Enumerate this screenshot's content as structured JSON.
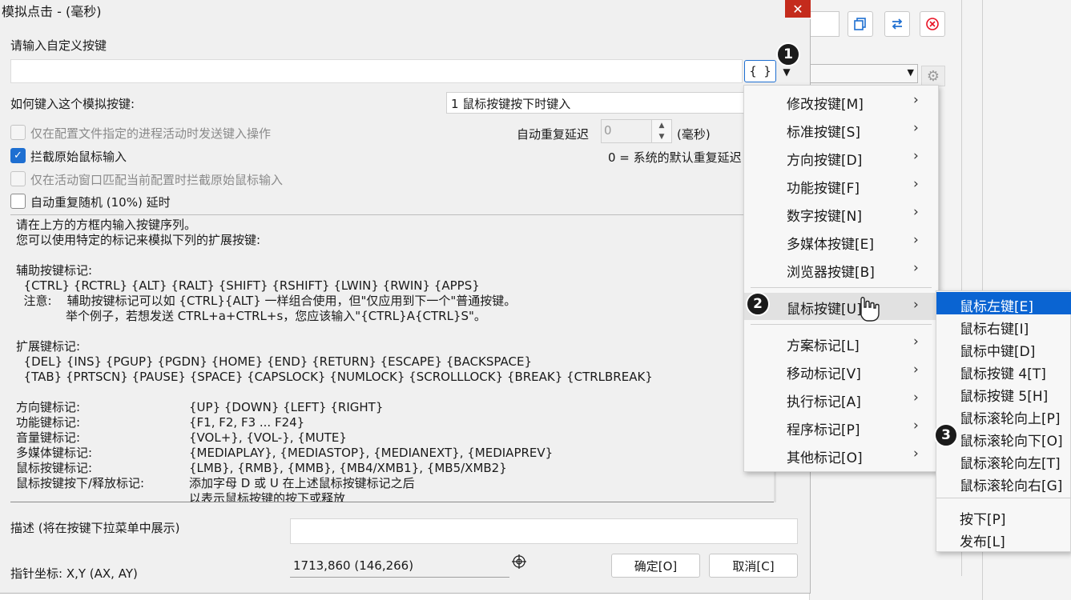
{
  "dialog": {
    "title": "模拟点击 - (毫秒)",
    "close_glyph": "✕",
    "input_label": "请输入自定义按键",
    "braces_label": "{ }",
    "how_label": "如何键入这个模拟按键:",
    "how_value": "1 鼠标按键按下时键入",
    "opt_process": "仅在配置文件指定的进程活动时发送键入操作",
    "opt_intercept": "拦截原始鼠标输入",
    "opt_window": "仅在活动窗口匹配当前配置时拦截原始鼠标输入",
    "opt_random": "自动重复随机 (10%) 延时",
    "repeat_label": "自动重复延迟",
    "repeat_value": "0",
    "repeat_unit": "(毫秒)",
    "repeat_note": "0 = 系统的默认重复延迟",
    "desc_label": "描述 (将在按键下拉菜单中展示)",
    "pointer_label": "指针坐标: X,Y (AX, AY)",
    "pointer_value": "1713,860 (146,266)",
    "ok_label": "确定[O]",
    "cancel_label": "取消[C]"
  },
  "help": {
    "l1": "请在上方的方框内输入按键序列。",
    "l2": "您可以使用特定的标记来模拟下列的扩展按键:",
    "l3": "辅助按键标记:",
    "l4": "  {CTRL} {RCTRL} {ALT} {RALT} {SHIFT} {RSHIFT} {LWIN} {RWIN} {APPS}",
    "l5": "  注意:    辅助按键标记可以如 {CTRL}{ALT} 一样组合使用，但\"仅应用到下一个\"普通按键。",
    "l6": "             举个例子，若想发送 CTRL+a+CTRL+s，您应该输入\"{CTRL}A{CTRL}S\"。",
    "l7": "扩展键标记:",
    "l8": "  {DEL} {INS} {PGUP} {PGDN} {HOME} {END} {RETURN} {ESCAPE} {BACKSPACE}",
    "l9": "  {TAB} {PRTSCN} {PAUSE} {SPACE} {CAPSLOCK} {NUMLOCK} {SCROLLLOCK} {BREAK} {CTRLBREAK}",
    "k1": "方向键标记:",
    "v1": "{UP} {DOWN} {LEFT} {RIGHT}",
    "k2": "功能键标记:",
    "v2": "{F1, F2, F3 ... F24}",
    "k3": "音量键标记:",
    "v3": "{VOL+}, {VOL-}, {MUTE}",
    "k4": "多媒体键标记:",
    "v4": "{MEDIAPLAY}, {MEDIASTOP}, {MEDIANEXT}, {MEDIAPREV}",
    "k5": "鼠标按键标记:",
    "v5": "{LMB}, {RMB}, {MMB}, {MB4/XMB1}, {MB5/XMB2}",
    "k6": "鼠标按键按下/释放标记:",
    "v6": "添加字母 D 或 U 在上述鼠标按键标记之后",
    "v7": "以表示鼠标按键的按下或释放"
  },
  "menu": {
    "items": [
      "修改按键[M]",
      "标准按键[S]",
      "方向按键[D]",
      "功能按键[F]",
      "数字按键[N]",
      "多媒体按键[E]",
      "浏览器按键[B]",
      "鼠标按键[U]",
      "方案标记[L]",
      "移动标记[V]",
      "执行标记[A]",
      "程序标记[P]",
      "其他标记[O]"
    ],
    "arrow": "›"
  },
  "submenu": {
    "items": [
      "鼠标左键[E]",
      "鼠标右键[I]",
      "鼠标中键[D]",
      "鼠标按键 4[T]",
      "鼠标按键 5[H]",
      "鼠标滚轮向上[P]",
      "鼠标滚轮向下[O]",
      "鼠标滚轮向左[T]",
      "鼠标滚轮向右[G]",
      "按下[P]",
      "发布[L]"
    ]
  },
  "markers": {
    "m1": "1",
    "m2": "2",
    "m3": "3"
  },
  "icons": {
    "copy": "copy-icon",
    "swap": "swap-icon",
    "delete": "delete-icon",
    "gear": "gear-icon",
    "crosshair": "crosshair-icon"
  },
  "colors": {
    "accent": "#1e6fd1",
    "close": "#c42b1c",
    "highlight": "#0a64d2",
    "delete_red": "#e81123"
  }
}
